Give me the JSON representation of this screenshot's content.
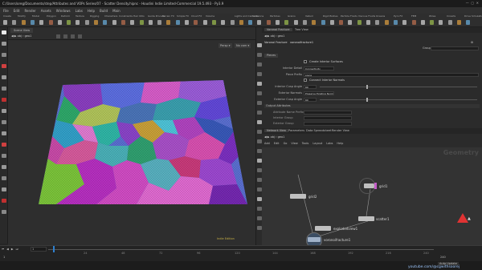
{
  "window": {
    "title": "C:/Users/oreg/Documents/step/Attributes and VOPs Series/07 - Scatter Density.hipnc - Houdini Indie Limited-Commercial 19.5.493 - Py3.9"
  },
  "menu": [
    "File",
    "Edit",
    "Render",
    "Assets",
    "Windows",
    "Labs",
    "Help",
    "Build",
    "Main"
  ],
  "shelf_tabs": [
    "Create",
    "Modify",
    "Model",
    "Polygon",
    "Deform",
    "Texture",
    "Rigging",
    "Characters",
    "Constraints",
    "Hair Utils",
    "Guide Process",
    "Terrain FX",
    "Simple FX",
    "Cloud FX",
    "Volume"
  ],
  "shelf_tabs2": [
    "Lights and Cameras",
    "Collisions",
    "Particles",
    "Grains",
    "Vellum",
    "Rigid Bodies",
    "Particle Fluids",
    "Viscous Fluids",
    "Oceans",
    "Pyro FX",
    "FEM",
    "Wires",
    "Crowds",
    "Drive Simulation"
  ],
  "viewport": {
    "tab_label": "Scene View",
    "path": "obj",
    "node": "geo1",
    "persp": "Persp",
    "cam": "No cam",
    "status_text": "Indie Edition"
  },
  "params": {
    "tabs": [
      "Voronoi Fracture",
      "Tree View"
    ],
    "path": "obj",
    "node": "geo1",
    "node_type": "Voronoi Fracture",
    "node_name": "voronoifracture1",
    "section_tab": "Group",
    "sub_tab": "Pieces",
    "rows": [
      {
        "label": "",
        "value": "Create Interior Surfaces",
        "type": "check"
      },
      {
        "label": "Interior Detail",
        "value": "Connectivity",
        "type": "menu"
      },
      {
        "label": "Piece Prefix",
        "value": "piece",
        "type": "text"
      },
      {
        "label": "",
        "value": "Connect Interior Normals",
        "type": "check"
      },
      {
        "label": "Interior Cusp Angle",
        "value": "60",
        "type": "slider"
      },
      {
        "label": "Exterior Normals",
        "value": "Preserve Existing Normals",
        "type": "menu"
      },
      {
        "label": "Exterior Cusp Angle",
        "value": "60",
        "type": "slider"
      }
    ],
    "output_header": "Output Attributes",
    "output_rows": [
      "Attribute Name Prefix",
      "Interior Group",
      "Exterior Group"
    ]
  },
  "network": {
    "tabs": [
      "Network View",
      "Parameters",
      "Data Spreadsheet",
      "Render View"
    ],
    "path": "obj",
    "node": "geo1",
    "menu": [
      "Add",
      "Edit",
      "Go",
      "View",
      "Tools",
      "Layout",
      "Labs",
      "Help"
    ],
    "context_label": "Geometry",
    "nodes": [
      {
        "name": "grid1"
      },
      {
        "name": "grid2"
      },
      {
        "name": "scatter1"
      },
      {
        "name": "voronoifracture1"
      },
      {
        "name": "explodedview1"
      }
    ]
  },
  "timeline": {
    "frame": "1",
    "start": "1",
    "end": "240",
    "ticks": [
      "24",
      "48",
      "72",
      "96",
      "120",
      "144",
      "168",
      "192",
      "216",
      "240"
    ],
    "auto_update": "Auto Update"
  },
  "watermark": "youtube.com/@cgwithsoorej"
}
